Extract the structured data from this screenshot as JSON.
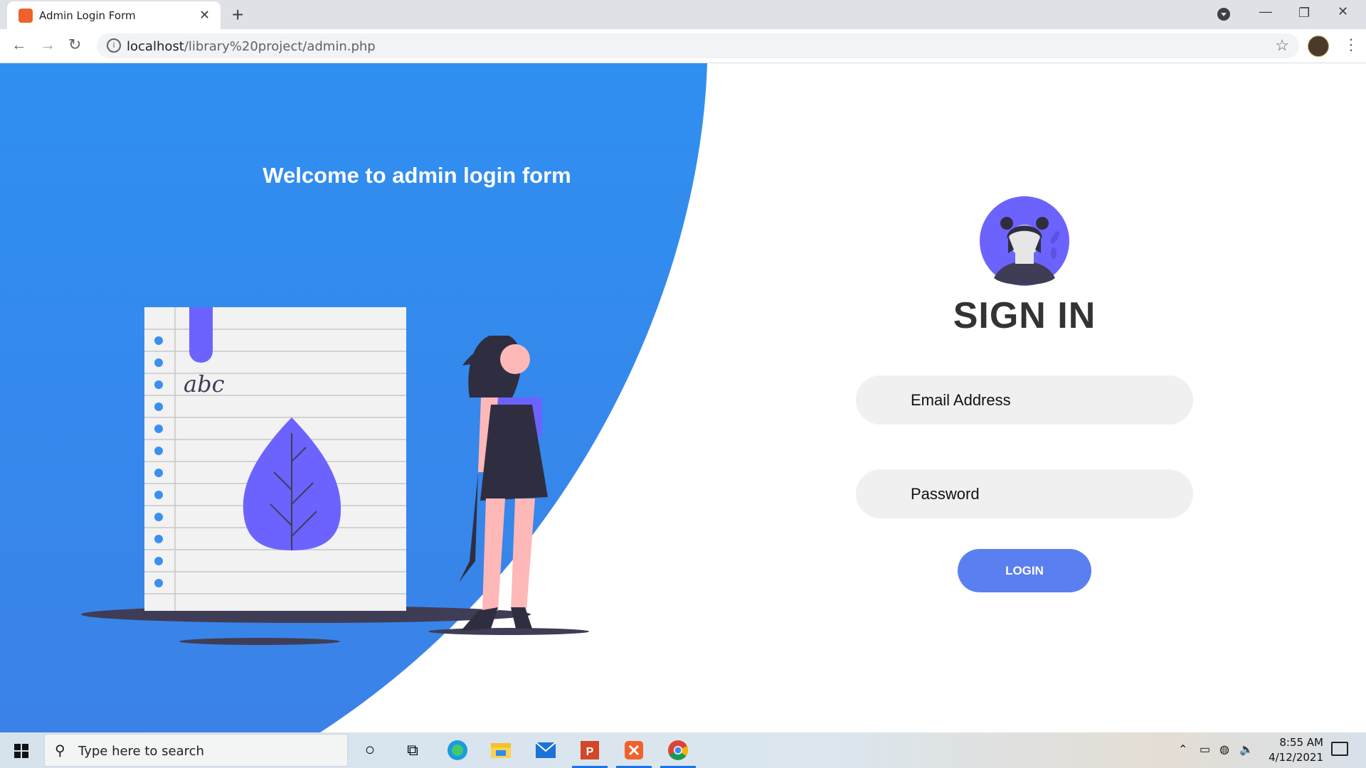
{
  "browser": {
    "tab_title": "Admin Login Form",
    "url_host": "localhost",
    "url_path": "/library%20project/admin.php"
  },
  "page": {
    "welcome": "Welcome to admin login form",
    "notebook_text": "abc",
    "sign_in_title": "SIGN IN",
    "email_placeholder": "Email Address",
    "password_placeholder": "Password",
    "login_label": "LOGIN",
    "colors": {
      "blue": "#3a8ff0",
      "accent": "#6c63ff",
      "login_button": "#5a7ff0"
    }
  },
  "taskbar": {
    "search_placeholder": "Type here to search",
    "time": "8:55 AM",
    "date": "4/12/2021",
    "pinned": [
      "cortana-icon",
      "task-view-icon",
      "edge-icon",
      "file-explorer-icon",
      "mail-icon",
      "powerpoint-icon",
      "xampp-icon",
      "chrome-icon"
    ]
  }
}
